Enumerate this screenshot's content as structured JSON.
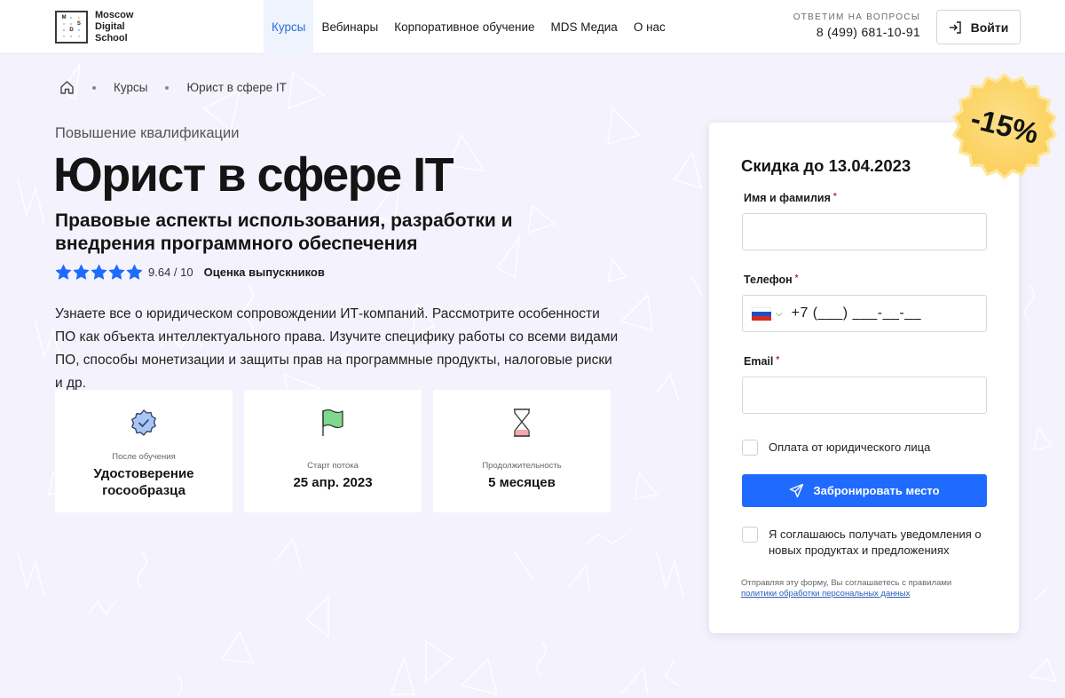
{
  "header": {
    "logo": {
      "letters": [
        "M",
        "S",
        "D"
      ],
      "lines": [
        "Moscow",
        "Digital",
        "School"
      ]
    },
    "nav": [
      {
        "label": "Курсы",
        "active": true
      },
      {
        "label": "Вебинары",
        "active": false
      },
      {
        "label": "Корпоративное обучение",
        "active": false
      },
      {
        "label": "MDS Медиа",
        "active": false
      },
      {
        "label": "О нас",
        "active": false
      }
    ],
    "contact_label": "ОТВЕТИМ НА ВОПРОСЫ",
    "contact_phone": "8 (499) 681-10-91",
    "login_label": "Войти",
    "login_icon": "login-icon"
  },
  "breadcrumb": {
    "home_icon": "home-icon",
    "items": [
      "Курсы",
      "Юрист в сфере IT"
    ]
  },
  "course": {
    "eyebrow": "Повышение квалификации",
    "title": "Юрист в сфере IT",
    "subtitle": "Правовые аспекты использования, разработки и внедрения программного обеспечения",
    "rating": {
      "stars": 5,
      "value": "9.64 / 10",
      "label": "Оценка выпускников",
      "star_color": "#1f6bff"
    },
    "description": "Узнаете все о юридическом сопровождении ИТ-компаний. Рассмотрите особенности ПО как объекта интеллектуального права. Изучите специфику работы со всеми видами ПО, способы монетизации и защиты прав на программные продукты, налоговые риски и др.",
    "cards": [
      {
        "icon": "badge-check-icon",
        "label": "После обучения",
        "value": "Удостоверение госообразца"
      },
      {
        "icon": "flag-icon",
        "label": "Старт потока",
        "value": "25 апр. 2023"
      },
      {
        "icon": "hourglass-icon",
        "label": "Продолжительность",
        "value": "5 месяцев"
      }
    ]
  },
  "form": {
    "discount_badge": "-15%",
    "title": "Скидка до 13.04.2023",
    "name_label": "Имя и фамилия",
    "name_value": "",
    "phone_label": "Телефон",
    "phone_country": "RU",
    "phone_value": "+7 (___) ___-__-__",
    "email_label": "Email",
    "email_value": "",
    "required_mark": "*",
    "legal_entity_label": "Оплата от юридического лица",
    "legal_entity_checked": false,
    "submit_label": "Забронировать место",
    "consent_label": "Я соглашаюсь получать уведомления о новых продуктах и предложениях",
    "consent_checked": false,
    "legal_text": "Отправляя эту форму, Вы соглашаетесь с правилами",
    "legal_link": "политики обработки персональных данных"
  },
  "colors": {
    "accent": "#1f6bff",
    "nav_active": "#2a6fd6",
    "background": "#f4f2fc",
    "badge": "#fdd46a"
  }
}
